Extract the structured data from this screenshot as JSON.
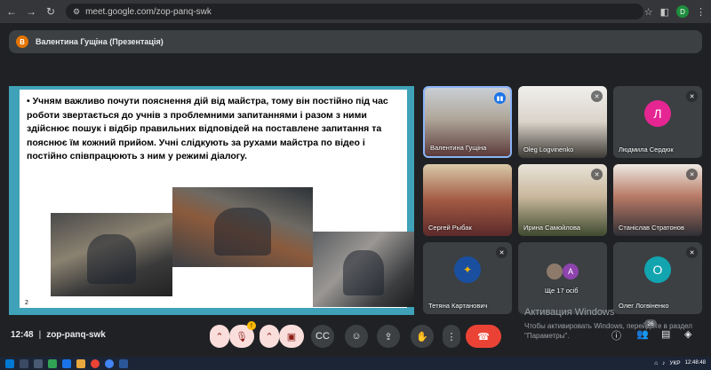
{
  "browser": {
    "url": "meet.google.com/zop-panq-swk",
    "profile_initial": "D"
  },
  "presenter_bar": {
    "initial": "В",
    "label": "Валентина Гущіна (Презентація)"
  },
  "slide": {
    "text": "• Учням важливо почути  пояснення дій від майстра, тому він постійно під час роботи звертається до учнів з проблемними запитаннями і разом з ними здійснює пошук і відбір правильних відповідей на поставлене запитання та пояснює  їм кожний прийом. Учні  слідкують за рухами майстра по відео і  постійно співпрацюють з ним у режимі діалогу.",
    "page": "2"
  },
  "participants": [
    {
      "name": "Валентина Гущіна",
      "type": "video",
      "mic": "active"
    },
    {
      "name": "Oleg Logvinenko",
      "type": "video",
      "mic": "muted"
    },
    {
      "name": "Людмила Сердюк",
      "type": "avatar",
      "initial": "Л",
      "color": "#e52592",
      "mic": "muted"
    },
    {
      "name": "Сергей Рыбак",
      "type": "video",
      "mic": "muted"
    },
    {
      "name": "Ирина Самойлова",
      "type": "video",
      "mic": "muted"
    },
    {
      "name": "Станіслав Стратонов",
      "type": "video",
      "mic": "muted"
    },
    {
      "name": "Тетяна Картанович",
      "type": "avatar",
      "initial": "",
      "color": "#1a4fa0",
      "mic": "muted"
    },
    {
      "name": "Ще 17 осіб",
      "type": "more",
      "initial": "А",
      "color": "#8e44ad"
    },
    {
      "name": "Олег Логвіненко",
      "type": "avatar",
      "initial": "О",
      "color": "#12a4af",
      "mic": "muted"
    }
  ],
  "watermark": {
    "title": "Активация Windows",
    "body": "Чтобы активировать Windows, перейдите в раздел \"Параметры\"."
  },
  "meeting": {
    "time": "12:48",
    "code": "zop-panq-swk",
    "participants_count": "26",
    "raise_badge": "!"
  },
  "taskbar": {
    "lang": "УКР",
    "time": "12:48:48",
    "date": "",
    "colors": [
      "#0078d4",
      "#e8a73b",
      "#31a354",
      "#d83b01",
      "#1a73e8",
      "#ea4335",
      "#4285f4",
      "#2b579a"
    ]
  }
}
